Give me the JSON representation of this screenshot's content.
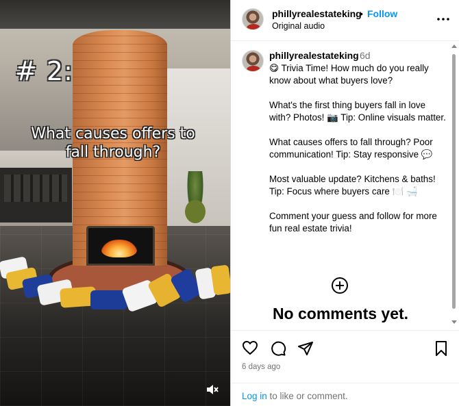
{
  "video": {
    "overlay_number": "# 2:",
    "overlay_question_line1": "What causes offers to",
    "overlay_question_line2": "fall through?",
    "mute_icon": "speaker-muted-icon"
  },
  "header": {
    "username": "phillyrealestateking",
    "separator": "•",
    "follow_label": "Follow",
    "audio_label": "Original audio",
    "more_icon": "more-options-icon"
  },
  "comment": {
    "username": "phillyrealestateking",
    "time": "6d",
    "caption": [
      "😋 Trivia Time! How much do you really know about what buyers love?",
      "What's the first thing buyers fall in love with? Photos! 📷 Tip: Online visuals matter.",
      "What causes offers to fall through? Poor communication! Tip: Stay responsive 💬",
      "Most valuable update? Kitchens & baths! Tip: Focus where buyers care 🍽️ 🛁",
      "Comment your guess and follow for more fun real estate trivia!"
    ]
  },
  "comments_area": {
    "add_icon": "plus-circle-icon",
    "empty_label": "No comments yet."
  },
  "actions": {
    "like_icon": "heart-icon",
    "comment_icon": "comment-bubble-icon",
    "share_icon": "send-icon",
    "save_icon": "bookmark-icon",
    "posted_ago": "6 days ago",
    "login_link": "Log in",
    "login_rest": " to like or comment."
  },
  "colors": {
    "accent": "#0095f6",
    "muted_text": "#737373",
    "border": "#dbdbdb"
  }
}
